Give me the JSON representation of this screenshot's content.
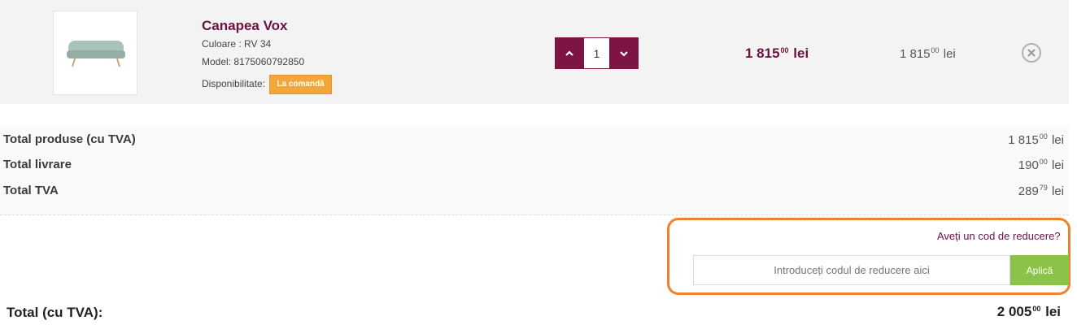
{
  "item": {
    "name": "Canapea Vox",
    "color_label": "Culoare : RV 34",
    "model_label": "Model: 8175060792850",
    "availability_label": "Disponibilitate:",
    "availability_badge": "La comandă",
    "quantity": "1",
    "price_int": "1 815",
    "price_dec": "00",
    "price_cur": "lei",
    "unit_price_int": "1 815",
    "unit_price_dec": "00",
    "unit_price_cur": "lei"
  },
  "totals": {
    "products_label": "Total produse (cu TVA)",
    "products_int": "1 815",
    "products_dec": "00",
    "products_cur": "lei",
    "shipping_label": "Total livrare",
    "shipping_int": "190",
    "shipping_dec": "00",
    "shipping_cur": "lei",
    "vat_label": "Total TVA",
    "vat_int": "289",
    "vat_dec": "79",
    "vat_cur": "lei"
  },
  "coupon": {
    "question": "Aveți un cod de reducere?",
    "placeholder": "Introduceți codul de reducere aici",
    "apply_label": "Aplică"
  },
  "grand_total": {
    "label": "Total (cu TVA):",
    "int": "2 005",
    "dec": "00",
    "cur": "lei"
  },
  "colors": {
    "brand": "#6b1241",
    "badge": "#f1a73b",
    "apply": "#8bc34a",
    "highlight": "#f0822f"
  },
  "icons": {
    "increase": "chevron-up-icon",
    "decrease": "chevron-down-icon",
    "remove": "close-circle-icon"
  }
}
